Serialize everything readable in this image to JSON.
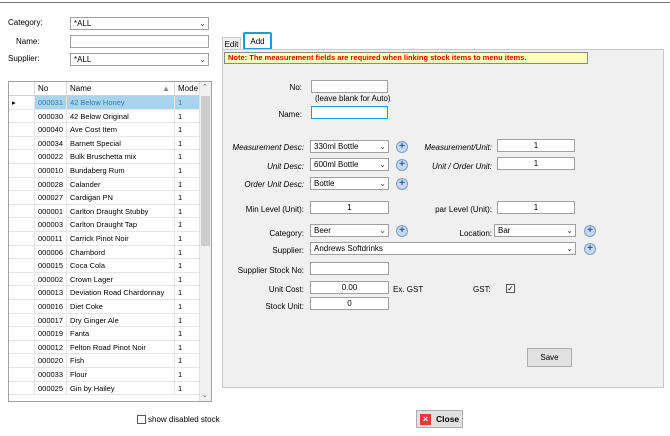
{
  "filters": {
    "category_label": "Category:",
    "category_value": "*ALL",
    "name_label": "Name:",
    "name_value": "",
    "supplier_label": "Supplier:",
    "supplier_value": "*ALL"
  },
  "grid": {
    "headers": {
      "no": "No",
      "name": "Name",
      "mode": "Mode"
    },
    "rows": [
      {
        "no": "000031",
        "name": "42 Below Honey",
        "mode": "1"
      },
      {
        "no": "000030",
        "name": "42 Below Original",
        "mode": "1"
      },
      {
        "no": "000040",
        "name": "Ave Cost Item",
        "mode": "1"
      },
      {
        "no": "000034",
        "name": "Barnett Special",
        "mode": "1"
      },
      {
        "no": "000022",
        "name": "Bulk Bruschetta mix",
        "mode": "1"
      },
      {
        "no": "000010",
        "name": "Bundaberg Rum",
        "mode": "1"
      },
      {
        "no": "000028",
        "name": "Calander",
        "mode": "1"
      },
      {
        "no": "000027",
        "name": "Cardigan PN",
        "mode": "1"
      },
      {
        "no": "000001",
        "name": "Carlton Draught Stubby",
        "mode": "1"
      },
      {
        "no": "000003",
        "name": "Carlton Draught Tap",
        "mode": "1"
      },
      {
        "no": "000011",
        "name": "Carrick Pinot Noir",
        "mode": "1"
      },
      {
        "no": "000006",
        "name": "Chambord",
        "mode": "1"
      },
      {
        "no": "000015",
        "name": "Coca Cola",
        "mode": "1"
      },
      {
        "no": "000002",
        "name": "Crown Lager",
        "mode": "1"
      },
      {
        "no": "000013",
        "name": "Deviation Road Chardonnay",
        "mode": "1"
      },
      {
        "no": "000016",
        "name": "Diet Coke",
        "mode": "1"
      },
      {
        "no": "000017",
        "name": "Dry Ginger Ale",
        "mode": "1"
      },
      {
        "no": "000019",
        "name": "Fanta",
        "mode": "1"
      },
      {
        "no": "000012",
        "name": "Felton Road Pinot Noir",
        "mode": "1"
      },
      {
        "no": "000020",
        "name": "Fish",
        "mode": "1"
      },
      {
        "no": "000033",
        "name": "Flour",
        "mode": "1"
      },
      {
        "no": "000025",
        "name": "Gin by Hailey",
        "mode": "1"
      }
    ]
  },
  "show_disabled": "show disabled stock",
  "tabs": {
    "edit": "Edit",
    "add": "Add"
  },
  "form": {
    "note": "Note: The measurement fields are required when linking stock items to menu items.",
    "no_label": "No:",
    "no_value": "",
    "no_hint": "(leave blank for Auto)",
    "name_label": "Name:",
    "name_value": "",
    "measurement_desc_label": "Measurement Desc:",
    "measurement_desc_value": "330ml Bottle",
    "measurement_unit_label": "Measurement/Unit:",
    "measurement_unit_value": "1",
    "unit_desc_label": "Unit Desc:",
    "unit_desc_value": "600ml Bottle",
    "unit_order_unit_label": "Unit / Order Unit:",
    "unit_order_unit_value": "1",
    "order_unit_desc_label": "Order Unit Desc:",
    "order_unit_desc_value": "Bottle",
    "min_level_label": "Min Level (Unit):",
    "min_level_value": "1",
    "par_level_label": "par Level (Unit):",
    "par_level_value": "1",
    "category_label": "Category:",
    "category_value": "Beer",
    "location_label": "Location:",
    "location_value": "Bar",
    "supplier_label": "Supplier:",
    "supplier_value": "Andrews Softdrinks",
    "supplier_stock_label": "Supplier Stock No:",
    "supplier_stock_value": "",
    "unit_cost_label": "Unit Cost:",
    "unit_cost_value": "0.00",
    "ex_gst": "Ex. GST",
    "gst_label": "GST:",
    "gst_checked": "✓",
    "stock_unit_label": "Stock Unit:",
    "stock_unit_value": "0",
    "save_label": "Save"
  },
  "close_label": "Close",
  "colors": {
    "highlight": "#1e9ad6",
    "note_text": "#e00000",
    "note_bg": "#ffffc0",
    "selected_row": "#a9d4ee"
  }
}
